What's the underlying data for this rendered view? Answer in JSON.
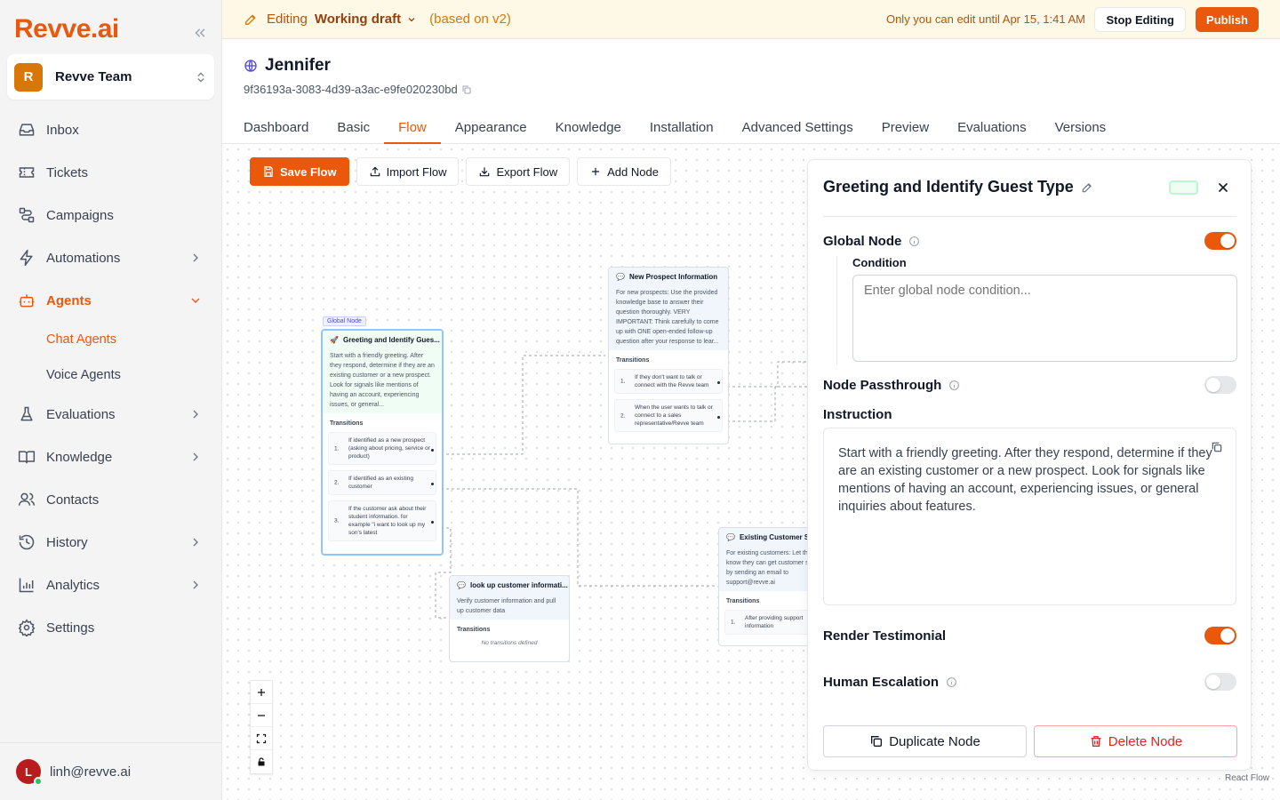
{
  "brand": {
    "logo_text": "Revve.ai",
    "accent": "#ea580c"
  },
  "team": {
    "initial": "R",
    "name": "Revve Team"
  },
  "nav": {
    "inbox": "Inbox",
    "tickets": "Tickets",
    "campaigns": "Campaigns",
    "automations": "Automations",
    "agents": "Agents",
    "chat_agents": "Chat Agents",
    "voice_agents": "Voice Agents",
    "evaluations": "Evaluations",
    "knowledge": "Knowledge",
    "contacts": "Contacts",
    "history": "History",
    "analytics": "Analytics",
    "settings": "Settings"
  },
  "user": {
    "initial": "L",
    "email": "linh@revve.ai"
  },
  "topbar": {
    "editing": "Editing",
    "draft": "Working draft",
    "based_on": "(based on v2)",
    "lock_notice": "Only you can edit until Apr 15, 1:41 AM",
    "stop_editing": "Stop Editing",
    "publish": "Publish"
  },
  "agent": {
    "name": "Jennifer",
    "id": "9f36193a-3083-4d39-a3ac-e9fe020230bd"
  },
  "tabs": [
    "Dashboard",
    "Basic",
    "Flow",
    "Appearance",
    "Knowledge",
    "Installation",
    "Advanced Settings",
    "Preview",
    "Evaluations",
    "Versions"
  ],
  "toolbar": {
    "save": "Save Flow",
    "import": "Import Flow",
    "export": "Export Flow",
    "add": "Add Node"
  },
  "canvas": {
    "global_badge": "Global Node",
    "transitions_label": "Transitions",
    "attribution": "React Flow",
    "nodes": {
      "greeting": {
        "title": "Greeting and Identify Gues...",
        "desc": "Start with a friendly greeting. After they respond, determine if they are an existing customer or a new prospect. Look for signals like mentions of having an account, experiencing issues, or general...",
        "transitions": [
          "If identified as a new prospect (asking about pricing, service or product)",
          "If identified as an existing customer",
          "If the customer ask about their student information. for example \"i want to look up my son's latest"
        ]
      },
      "prospect": {
        "title": "New Prospect Information",
        "desc": "For new prospects: Use the provided knowledge base to answer their question thoroughly. VERY IMPORTANT: Think carefully to come up with ONE open-ended follow-up question after your response to lear...",
        "transitions": [
          "If they don't want to talk or connect with the Revve team",
          "When the user wants to talk or connect to a sales representative/Revve team"
        ]
      },
      "lookup": {
        "title": "look up customer informati...",
        "desc": "Verify customer information and pull up customer data",
        "empty": "No transitions defined"
      },
      "existing": {
        "title": "Existing Customer Su...",
        "desc": "For existing customers: Let them know they can get customer support by sending an email to support@revve.ai",
        "transitions": [
          "After providing support information"
        ]
      }
    }
  },
  "panel": {
    "title": "Greeting and Identify Guest Type",
    "global_node": "Global Node",
    "global_node_on": true,
    "condition_label": "Condition",
    "condition_placeholder": "Enter global node condition...",
    "passthrough": "Node Passthrough",
    "passthrough_on": false,
    "instruction_label": "Instruction",
    "instruction": "Start with a friendly greeting. After they respond, determine if they are an existing customer or a new prospect. Look for signals like mentions of having an account, experiencing issues, or general inquiries about features.",
    "render_testimonial": "Render Testimonial",
    "render_testimonial_on": true,
    "human_escalation": "Human Escalation",
    "human_escalation_on": false,
    "duplicate": "Duplicate Node",
    "delete": "Delete Node"
  }
}
